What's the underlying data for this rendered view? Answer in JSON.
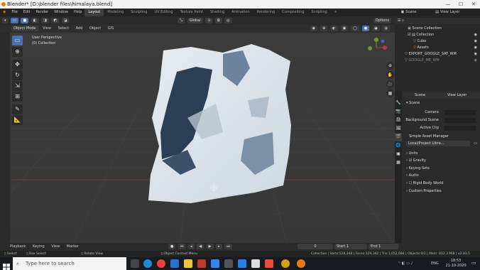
{
  "window": {
    "title": "Blender* [D:\\blender files\\himalaya.blend]",
    "min": "—",
    "max": "☐",
    "close": "✕"
  },
  "menu": [
    "File",
    "Edit",
    "Render",
    "Window",
    "Help"
  ],
  "workspaces": [
    "Layout",
    "Modeling",
    "Sculpting",
    "UV Editing",
    "Texture Paint",
    "Shading",
    "Animation",
    "Rendering",
    "Compositing",
    "Scripting"
  ],
  "active_workspace": "Layout",
  "add_ws": "+",
  "scene": {
    "label": "Scene",
    "view_layer": "View Layer"
  },
  "viewport": {
    "mode": "Object Mode",
    "menus": [
      "View",
      "Select",
      "Add",
      "Object",
      "GIS"
    ],
    "transform": "Global",
    "options": "Options",
    "overlay_title": "User Perspective",
    "overlay_sub": "(0) Collection"
  },
  "outliner": {
    "items": [
      {
        "label": "Scene Collection",
        "indent": 0
      },
      {
        "label": "Collection",
        "indent": 1
      },
      {
        "label": "Cube",
        "indent": 2
      },
      {
        "label": "Assets",
        "indent": 2
      },
      {
        "label": "EXPORT_GOOGLE_SAT_WM",
        "indent": 1
      },
      {
        "label": "GOOGLE_ME_WM",
        "indent": 1
      }
    ]
  },
  "properties": {
    "scene_label": "Scene",
    "view_layer": "View Layer",
    "section": "Scene",
    "camera": "Camera",
    "background_scene": "Background Scene",
    "active_clip": "Active Clip",
    "asset_manager": "Simple Asset Manager",
    "library": "Local/Project Libra...",
    "panels": [
      "Units",
      "Gravity",
      "Keying Sets",
      "Audio",
      "Rigid Body World",
      "Custom Properties"
    ]
  },
  "timeline": {
    "menus": [
      "Playback",
      "Keying",
      "View",
      "Marker"
    ],
    "frame": "0",
    "start_label": "Start",
    "start": "1",
    "end_label": "End",
    "end": "1"
  },
  "statusbar": {
    "select": "Select",
    "box_select": "Box Select",
    "rotate": "Rotate View",
    "context": "Object Context Menu",
    "stats": "Collection | Verts:528,348 | Faces:329,342 | Tris:1,052,684 | Objects:0/2 | Mem: 812.3 MiB | v2.83.5"
  },
  "taskbar": {
    "search_placeholder": "Type here to search",
    "lang": "ENG",
    "time": "18:53",
    "date": "21-10-2020"
  },
  "colors": {
    "accent": "#4772b3",
    "blender_orange": "#e87d0d"
  }
}
